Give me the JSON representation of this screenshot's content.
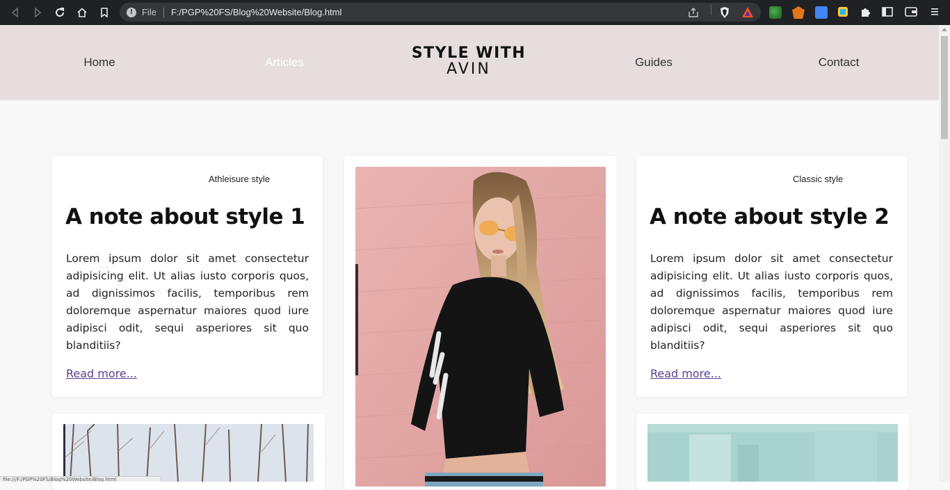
{
  "browser": {
    "file_label": "File",
    "url": "F:/PGP%20FS/Blog%20Website/Blog.html",
    "status_url": "file:///F:/PGP%20FS/Blog%20Website/Blog.html"
  },
  "nav": {
    "items": [
      {
        "label": "Home"
      },
      {
        "label": "Articles"
      },
      {
        "label": "Guides"
      },
      {
        "label": "Contact"
      }
    ],
    "logo_line1": "STYLE WITH",
    "logo_line2": "AVIN"
  },
  "cards": [
    {
      "tag": "Athleisure style",
      "title": "A note about style 1",
      "body": "Lorem ipsum dolor sit amet consectetur adipisicing elit. Ut alias iusto corporis quos, ad dignissimos facilis, temporibus rem doloremque aspernatur maiores quod iure adipisci odit, sequi asperiores sit quo blanditiis?",
      "link": "Read more..."
    },
    {
      "tag": "Classic style",
      "title": "A note about style 2",
      "body": "Lorem ipsum dolor sit amet consectetur adipisicing elit. Ut alias iusto corporis quos, ad dignissimos facilis, temporibus rem doloremque aspernatur maiores quod iure adipisci odit, sequi asperiores sit quo blanditiis?",
      "link": "Read more..."
    }
  ],
  "colors": {
    "header_bg": "#e6dede",
    "page_bg": "#f8f8f8",
    "link": "#5b3e8e",
    "photo_wall": "#e3a9a8"
  }
}
